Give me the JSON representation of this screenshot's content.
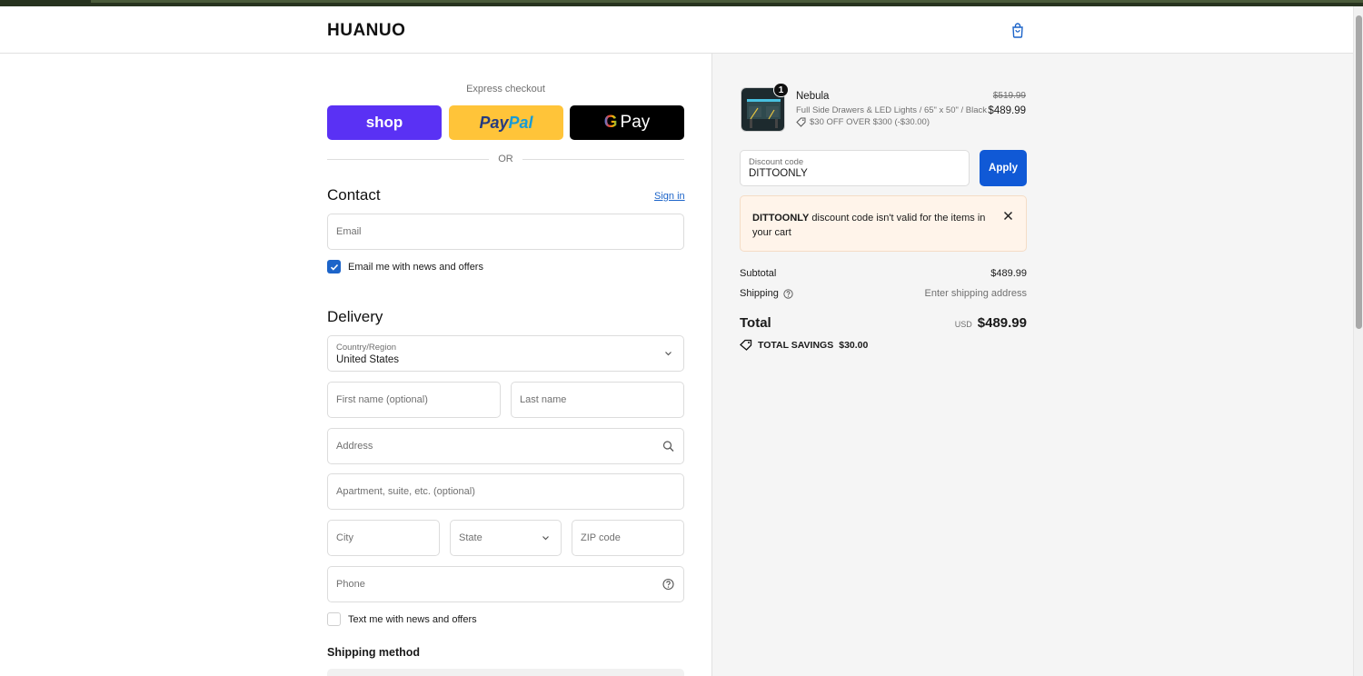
{
  "header": {
    "logo": "HUANUO"
  },
  "express": {
    "label": "Express checkout",
    "shop_label": "shop",
    "paypal_label_1": "Pay",
    "paypal_label_2": "Pal",
    "gpay_g": "G",
    "gpay_label": "Pay",
    "or": "OR"
  },
  "contact": {
    "heading": "Contact",
    "signin": "Sign in",
    "email_placeholder": "Email",
    "news_label": "Email me with news and offers",
    "news_checked": true
  },
  "delivery": {
    "heading": "Delivery",
    "country_label": "Country/Region",
    "country_value": "United States",
    "first_name": "First name (optional)",
    "last_name": "Last name",
    "address": "Address",
    "apartment": "Apartment, suite, etc. (optional)",
    "city": "City",
    "state": "State",
    "zip": "ZIP code",
    "phone": "Phone",
    "text_label": "Text me with news and offers",
    "text_checked": false
  },
  "shipping_method": {
    "heading": "Shipping method"
  },
  "summary": {
    "qty": "1",
    "product_name": "Nebula",
    "variant": "Full Side Drawers & LED Lights / 65\" x 50\" / Black",
    "discount_line": "$30 OFF OVER $300 (-$30.00)",
    "old_price": "$519.99",
    "price": "$489.99",
    "discount_label": "Discount code",
    "discount_value": "DITTOONLY",
    "apply": "Apply",
    "alert_code": "DITTOONLY",
    "alert_text": " discount code isn't valid for the items in your cart",
    "subtotal_label": "Subtotal",
    "subtotal_value": "$489.99",
    "shipping_label": "Shipping",
    "shipping_value": "Enter shipping address",
    "total_label": "Total",
    "currency": "USD",
    "total_value": "$489.99",
    "savings_label": "TOTAL SAVINGS",
    "savings_value": "$30.00"
  },
  "colors": {
    "accent": "#1059d6",
    "shop": "#5a31f4",
    "paypal": "#ffc439"
  },
  "icons": [
    "bag-icon",
    "search-icon",
    "help-icon",
    "chevron-down-icon",
    "tag-icon",
    "close-icon",
    "check-icon"
  ]
}
